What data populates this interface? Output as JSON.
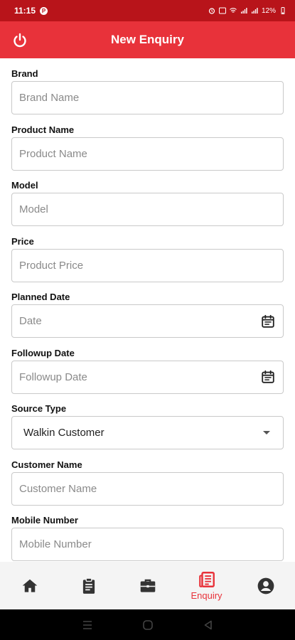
{
  "status_bar": {
    "time": "11:15",
    "app_badge": "P",
    "battery": "12%"
  },
  "app_bar": {
    "title": "New Enquiry"
  },
  "form": {
    "brand": {
      "label": "Brand",
      "placeholder": "Brand Name"
    },
    "product_name": {
      "label": "Product Name",
      "placeholder": "Product Name"
    },
    "model": {
      "label": "Model",
      "placeholder": "Model"
    },
    "price": {
      "label": "Price",
      "placeholder": "Product Price"
    },
    "planned_date": {
      "label": "Planned Date",
      "placeholder": "Date"
    },
    "followup_date": {
      "label": "Followup Date",
      "placeholder": "Followup Date"
    },
    "source_type": {
      "label": "Source Type",
      "value": "Walkin Customer"
    },
    "customer_name": {
      "label": "Customer Name",
      "placeholder": "Customer Name"
    },
    "mobile_number": {
      "label": "Mobile Number",
      "placeholder": "Mobile Number"
    }
  },
  "bottom_nav": {
    "active_label": "Enquiry",
    "accent_color": "#e8323a",
    "icon_color": "#333333"
  },
  "colors": {
    "header": "#e8323a",
    "status_bar": "#b8141a"
  }
}
